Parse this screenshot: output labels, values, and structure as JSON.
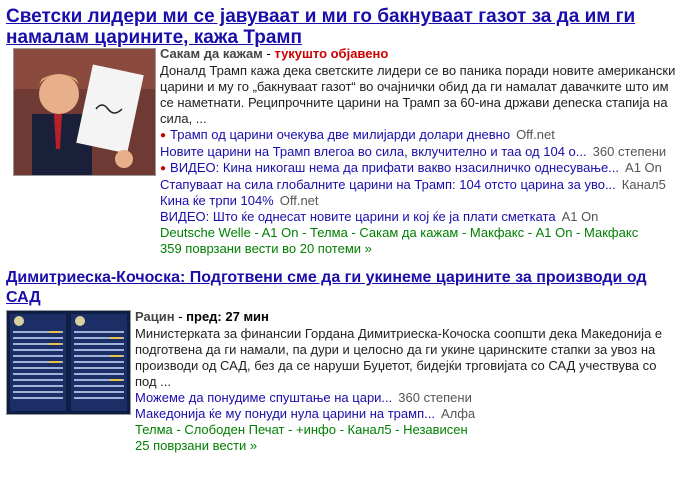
{
  "stories": [
    {
      "headline": "Светски лидери ми се јавуваат и ми го бакнуваат газот за да им ги намалам царините, кажа Трамп",
      "source": "Сакам да кажам",
      "time": "тукушто објавено",
      "snippet": "Доналд Трамп кажа дека светските лидери се во паника поради новите американски царини и му го „бакнуваат газот“ во очајнички обид да ги намалат давачките што им се наметнати. Реципрочните царини на Трамп за 60-ина држави деneска стапија на сила, ...",
      "related": [
        {
          "title": "Трамп од царини очекува две милијарди долари дневно",
          "source": "Off.net",
          "bullet": true
        },
        {
          "title": "Новите царини на Трамп влегоа во сила, вклучително и таа од 104 о...",
          "source": "360 степени",
          "bullet": false
        },
        {
          "title": "ВИДЕО: Кина никогаш нема да прифати вакво нзасилничко однесување...",
          "source": "A1 On",
          "bullet": true
        },
        {
          "title": "Стапуваат на сила глобалните царини на Трамп: 104 отсто царина за уво...",
          "source": "Канал5",
          "bullet": false
        },
        {
          "title": "Кина ќе трпи 104%",
          "source": "Off.net",
          "bullet": false
        },
        {
          "title": "ВИДЕО: Што ќе однесат новите царини и кој ќе ја плати сметката",
          "source": "A1 On",
          "bullet": false
        }
      ],
      "sources_line": "Deutsche Welle - A1 On - Телма - Сакам да кажам - Макфакс - A1 On - Макфакс",
      "more": "359 поврзани вести во 20 потеми »"
    },
    {
      "headline": "Димитриеска-Кочоска: Подготвени сме да ги укинеме царините за производи од САД",
      "source": "Рацин",
      "time": "пред: 27 мин",
      "snippet": "Министерката за финансии Гордана Димитриеска-Кочоска соопшти дека Македонија е подготвена да ги намали, па дури и целосно да ги укине царинските стапки за увоз на производи од САД, без да се наруши Буџетот, бидејќи трговијата со САД учествува со под ...",
      "related": [
        {
          "title": "Можеме да понудиме спуштање на цари...",
          "source": "360 степени",
          "bullet": false
        },
        {
          "title": "Македонија ќе му понуди нула царини на трамп...",
          "source": "Алфа",
          "bullet": false
        }
      ],
      "sources_line": "Телма - Слободен Печат - +инфо - Канал5 - Независен",
      "more": "25 поврзани вести »"
    }
  ]
}
